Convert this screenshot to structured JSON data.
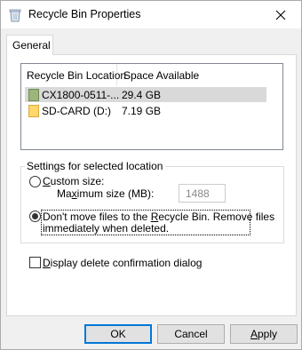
{
  "window": {
    "title": "Recycle Bin Properties"
  },
  "icons": {
    "title": "recycle-bin-icon",
    "close": "close-icon",
    "drive": "drive-icon",
    "sdcard": "sd-card-icon"
  },
  "tabs": [
    {
      "label": "General"
    }
  ],
  "list": {
    "columns": [
      "Recycle Bin Location",
      "Space Available"
    ],
    "rows": [
      {
        "location": "CX1800-0511-...",
        "space": "29.4 GB"
      },
      {
        "location": "SD-CARD (D:)",
        "space": "7.19 GB"
      }
    ]
  },
  "settings": {
    "group_label": "Settings for selected location",
    "custom_size_label": "Custom size:",
    "max_size_label": "Maximum size (MB):",
    "max_size_value": "1488",
    "dont_move_line1": "Don't move files to the Recycle Bin. Remove files",
    "dont_move_line2": "immediately when deleted.",
    "selected_option": "dont_move"
  },
  "display_confirmation": {
    "label": "Display delete confirmation dialog",
    "checked": false
  },
  "buttons": {
    "ok": "OK",
    "cancel": "Cancel",
    "apply": "Apply"
  },
  "colors": {
    "accent": "#0078d7",
    "selection": "#d9d9d9",
    "folder": "#ffd76b",
    "drive": "#9bb57a"
  }
}
